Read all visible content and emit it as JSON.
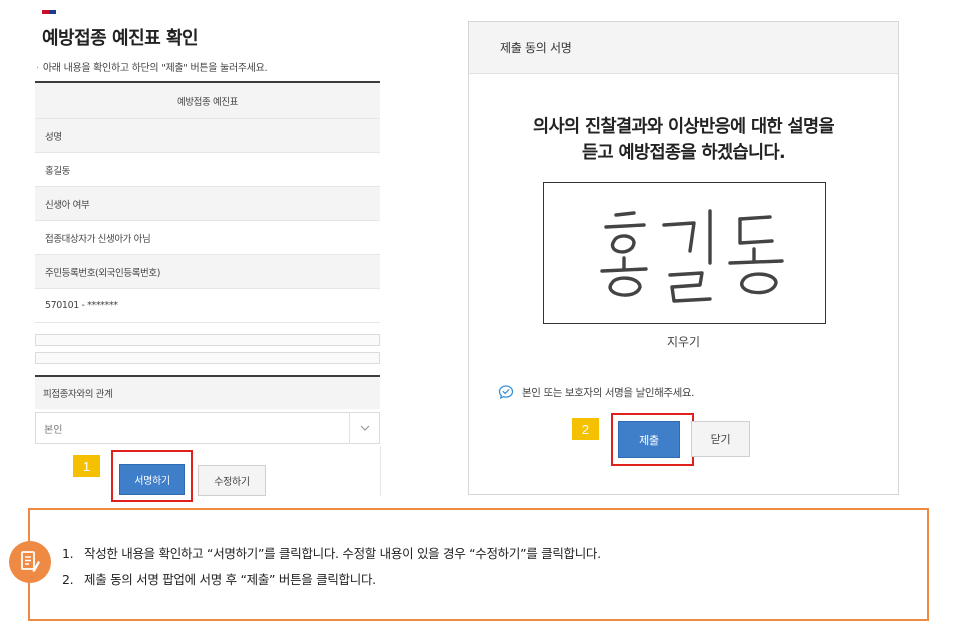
{
  "left": {
    "title": "예방접종 예진표 확인",
    "guide": "아래 내용을 확인하고 하단의 \"제출\" 버튼을 눌러주세요.",
    "table": {
      "header": "예방접종 예진표",
      "rows": [
        {
          "label": "성명",
          "value": "홍길동"
        },
        {
          "label": "신생아 여부",
          "value": "접종대상자가 신생아가 아님"
        },
        {
          "label": "주민등록번호(외국인등록번호)",
          "value": "570101 - *******"
        }
      ]
    },
    "relation": {
      "label": "피접종자와의 관계",
      "selected": "본인"
    },
    "buttons": {
      "sign": "서명하기",
      "edit": "수정하기"
    }
  },
  "popup": {
    "header": "제출 동의 서명",
    "message_line1": "의사의 진찰결과와 이상반응에 대한 설명을",
    "message_line2": "듣고 예방접종을 하겠습니다.",
    "signature": "홍길동",
    "erase": "지우기",
    "notice": "본인 또는 보호자의 서명을 날인해주세요.",
    "buttons": {
      "submit": "제출",
      "close": "닫기"
    }
  },
  "steps": {
    "step1": "1",
    "step2": "2"
  },
  "guide_box": {
    "items": [
      {
        "num": "1.",
        "text": "작성한 내용을 확인하고 “서명하기”를 클릭합니다. 수정할 내용이 있을 경우 “수정하기”를 클릭합니다."
      },
      {
        "num": "2.",
        "text": "제출 동의 서명 팝업에 서명 후 “제출” 버튼을 클릭합니다."
      }
    ]
  },
  "colors": {
    "primary_button": "#3f7ec9",
    "highlight": "#e0201c",
    "step_badge": "#f5c000",
    "guide_border": "#ef8a44",
    "notice_icon": "#3a8fd6"
  },
  "icons": {
    "flag": "flag-icon",
    "chevron": "chevron-down-icon",
    "notice": "chat-check-icon",
    "guide": "memo-pencil-icon"
  }
}
